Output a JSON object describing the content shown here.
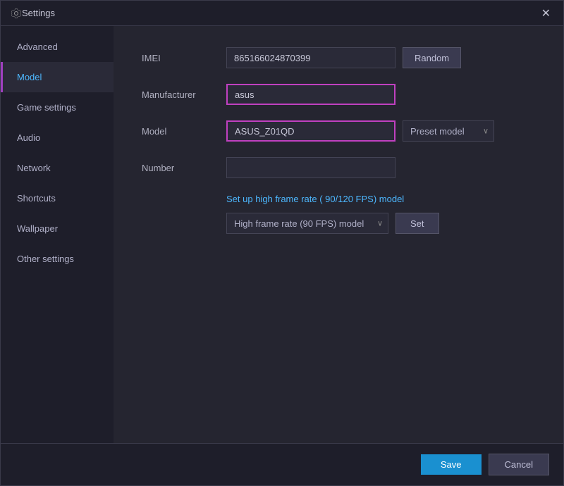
{
  "titleBar": {
    "title": "Settings",
    "closeLabel": "✕"
  },
  "sidebar": {
    "items": [
      {
        "id": "advanced",
        "label": "Advanced",
        "active": false
      },
      {
        "id": "model",
        "label": "Model",
        "active": true
      },
      {
        "id": "game-settings",
        "label": "Game settings",
        "active": false
      },
      {
        "id": "audio",
        "label": "Audio",
        "active": false
      },
      {
        "id": "network",
        "label": "Network",
        "active": false
      },
      {
        "id": "shortcuts",
        "label": "Shortcuts",
        "active": false
      },
      {
        "id": "wallpaper",
        "label": "Wallpaper",
        "active": false
      },
      {
        "id": "other-settings",
        "label": "Other settings",
        "active": false
      }
    ]
  },
  "form": {
    "imei": {
      "label": "IMEI",
      "value": "865166024870399",
      "placeholder": ""
    },
    "manufacturer": {
      "label": "Manufacturer",
      "value": "asus",
      "placeholder": ""
    },
    "model": {
      "label": "Model",
      "value": "ASUS_Z01QD",
      "placeholder": "",
      "presetLabel": "Preset model"
    },
    "number": {
      "label": "Number",
      "value": "",
      "placeholder": ""
    },
    "highFpsLink": "Set up high frame rate ( 90/120 FPS) model",
    "highFpsOption": "High frame rate (90 FPS) model",
    "setLabel": "Set",
    "randomLabel": "Random"
  },
  "footer": {
    "saveLabel": "Save",
    "cancelLabel": "Cancel"
  }
}
